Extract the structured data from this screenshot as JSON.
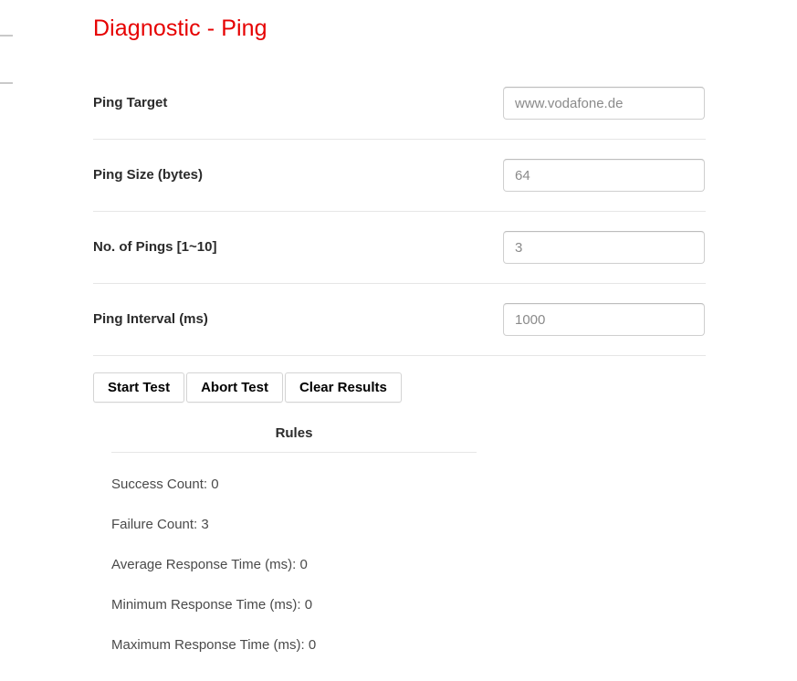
{
  "page": {
    "title": "Diagnostic - Ping"
  },
  "form": {
    "fields": [
      {
        "label": "Ping Target",
        "value": "www.vodafone.de",
        "placeholder": "www.vodafone.de",
        "name": "ping-target"
      },
      {
        "label": "Ping Size (bytes)",
        "value": "64",
        "placeholder": "64",
        "name": "ping-size"
      },
      {
        "label": "No. of Pings [1~10]",
        "value": "3",
        "placeholder": "3",
        "name": "ping-count"
      },
      {
        "label": "Ping Interval (ms)",
        "value": "1000",
        "placeholder": "1000",
        "name": "ping-interval"
      }
    ]
  },
  "buttons": {
    "start": "Start Test",
    "abort": "Abort Test",
    "clear": "Clear Results"
  },
  "results": {
    "title": "Rules",
    "rows": [
      "Success Count: 0",
      "Failure Count: 3",
      "Average Response Time (ms): 0",
      "Minimum Response Time (ms): 0",
      "Maximum Response Time (ms): 0"
    ]
  },
  "colors": {
    "title_red": "#e60000",
    "label_text": "#2b2b2b",
    "input_text": "#8a8a8a",
    "divider": "#e6e6e6",
    "button_border": "#d4d4d4"
  }
}
